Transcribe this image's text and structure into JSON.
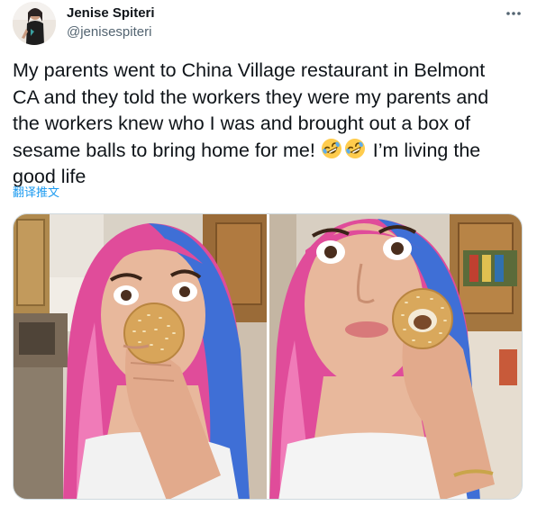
{
  "author": {
    "display_name": "Jenise Spiteri",
    "handle": "@jenisespiteri"
  },
  "more_icon": "more-horizontal-icon",
  "tweet": {
    "line1": "My parents went to China Village restaurant in Belmont",
    "line2": "CA and they told the workers they were my parents and",
    "line3": "the workers knew who I was and brought out a box of",
    "line4_prefix": "sesame balls to bring home for me! ",
    "emoji": "rolling-on-the-floor-laughing-emoji",
    "line4_suffix": " I’m living the",
    "line5": "good life"
  },
  "translate_label": "翻译推文",
  "media": {
    "photo_count": 2
  },
  "colors": {
    "text": "#0f1419",
    "secondary": "#536471",
    "link": "#1d9bf0",
    "border": "#cfd9de"
  }
}
